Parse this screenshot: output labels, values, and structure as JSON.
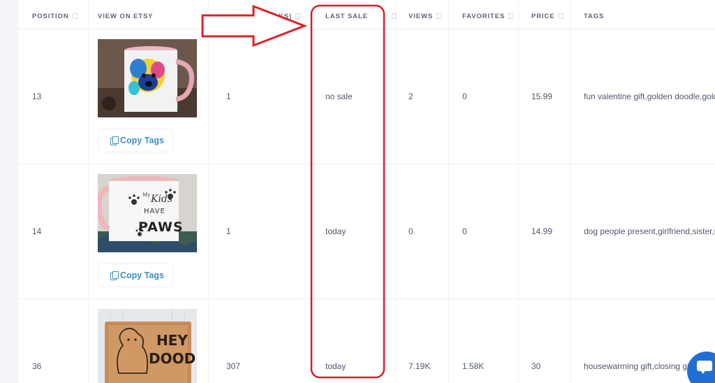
{
  "columns": {
    "position": "POSITION",
    "view_on_etsy": "VIEW ON ETSY",
    "hidden_col": "KS)",
    "last_sale": "LAST SALE",
    "views": "VIEWS",
    "favorites": "FAVORITES",
    "price": "PRICE",
    "tags": "TAGS"
  },
  "copy_tags_label": "Copy Tags",
  "rows": [
    {
      "position": "13",
      "hidden_col": "1",
      "last_sale": "no sale",
      "views": "2",
      "favorites": "0",
      "price": "15.99",
      "tags": "fun valentine gift,golden doodle,golde",
      "image_alt": "mug with colorful doodle dog portrait"
    },
    {
      "position": "14",
      "hidden_col": "1",
      "last_sale": "today",
      "views": "0",
      "favorites": "0",
      "price": "14.99",
      "tags": "dog people present,girlfriend,sister,m",
      "image_alt": "mug with My Kids Have Paws text",
      "image_text": [
        "My",
        "Kids",
        "HAVE",
        "PAWS"
      ]
    },
    {
      "position": "36",
      "hidden_col": "307",
      "last_sale": "today",
      "views": "7.19K",
      "favorites": "1.58K",
      "price": "30",
      "tags": "housewarming gift,closing gift",
      "image_alt": "doormat with doodle dog and Hey Dood text",
      "image_text": [
        "HEY",
        "DOOD"
      ]
    }
  ],
  "annotation": {
    "arrow_color": "#e0202a",
    "box_color": "#d4202e"
  },
  "chat_widget": {
    "icon": "chat-bubble-icon",
    "color": "#1f6fd6"
  }
}
